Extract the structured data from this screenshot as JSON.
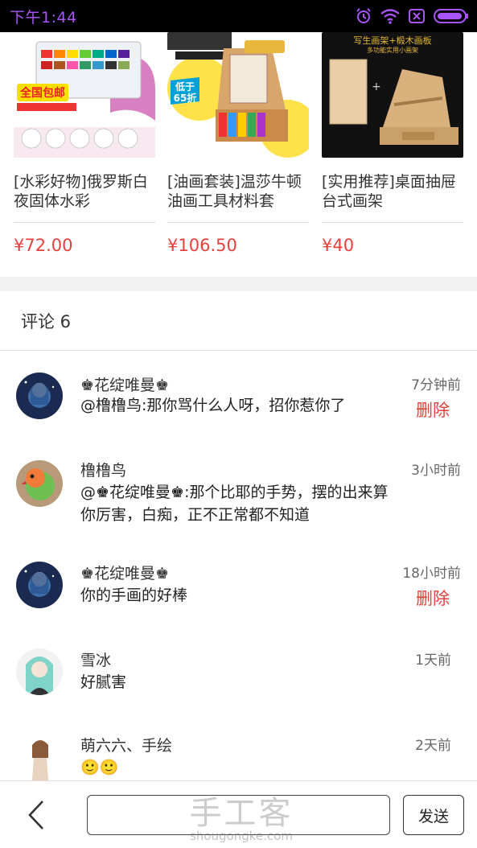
{
  "status_bar": {
    "time": "下午1:44",
    "accent_color": "#a855f7",
    "icons": [
      "alarm-icon",
      "wifi-icon",
      "sim-icon",
      "battery-icon"
    ]
  },
  "products": [
    {
      "title": "[水彩好物]俄罗斯白夜固体水彩",
      "price": "¥72.00",
      "image_badge": "全国包邮"
    },
    {
      "title": "[油画套装]温莎牛顿油画工具材料套",
      "price": "¥106.50",
      "image_badge": "低于65折"
    },
    {
      "title": "[实用推荐]桌面抽屉台式画架",
      "price": "¥40"
    }
  ],
  "comments_section": {
    "title": "评论 6"
  },
  "comments": [
    {
      "name": "♚花绽唯曼♚",
      "time": "7分钟前",
      "text": "@橹橹鸟:那你骂什么人呀，招你惹你了",
      "delete_label": "删除"
    },
    {
      "name": "橹橹鸟",
      "time": "3小时前",
      "text": "@♚花绽唯曼♚:那个比耶的手势，摆的出来算你厉害，白痴，正不正常都不知道"
    },
    {
      "name": "♚花绽唯曼♚",
      "time": "18小时前",
      "text": "你的手画的好棒",
      "delete_label": "删除"
    },
    {
      "name": "雪冰",
      "time": "1天前",
      "text": "好腻害"
    },
    {
      "name": "萌六六、手绘",
      "time": "2天前",
      "text": "🙂🙂"
    }
  ],
  "bottom_bar": {
    "input_value": "",
    "input_placeholder": "",
    "send_label": "发送"
  },
  "watermark": {
    "main": "手工客",
    "sub": "shougongke.com"
  },
  "colors": {
    "price": "#e8413c",
    "delete": "#e8413c",
    "status_bar_bg": "#000000"
  }
}
